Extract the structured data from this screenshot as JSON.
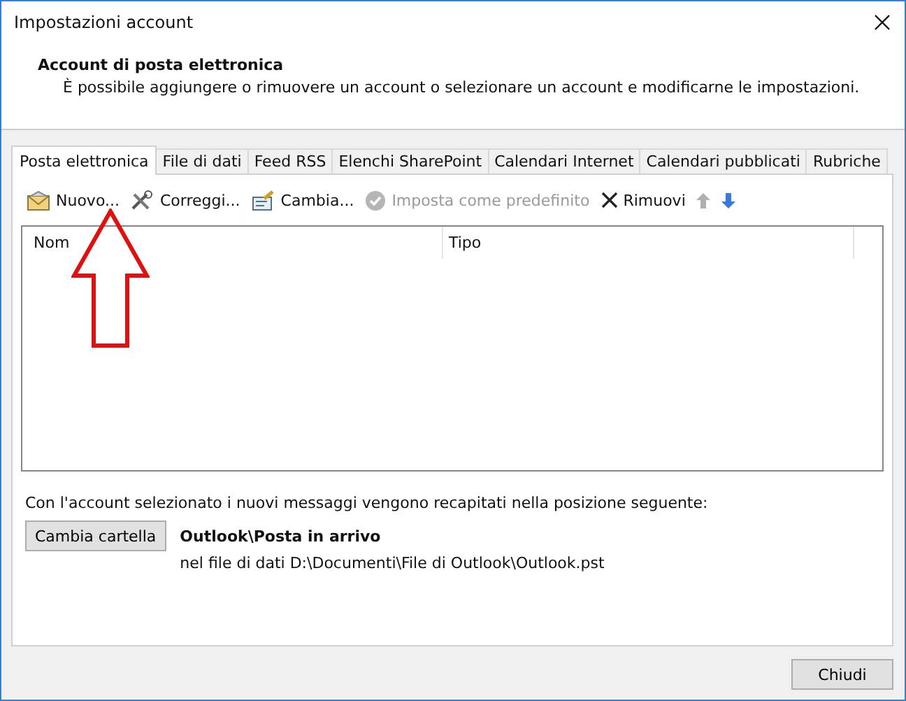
{
  "window": {
    "title": "Impostazioni account"
  },
  "header": {
    "title": "Account di posta elettronica",
    "description": "È possibile aggiungere o rimuovere un account o selezionare un account e modificarne le impostazioni."
  },
  "tabs": [
    {
      "label": "Posta elettronica",
      "selected": true
    },
    {
      "label": "File di dati",
      "selected": false
    },
    {
      "label": "Feed RSS",
      "selected": false
    },
    {
      "label": "Elenchi SharePoint",
      "selected": false
    },
    {
      "label": "Calendari Internet",
      "selected": false
    },
    {
      "label": "Calendari pubblicati",
      "selected": false
    },
    {
      "label": "Rubriche",
      "selected": false
    }
  ],
  "toolbar": [
    {
      "kind": "new",
      "label": "Nuovo...",
      "disabled": false
    },
    {
      "kind": "repair",
      "label": "Correggi...",
      "disabled": false
    },
    {
      "kind": "change",
      "label": "Cambia...",
      "disabled": false
    },
    {
      "kind": "default",
      "label": "Imposta come predefinito",
      "disabled": true
    },
    {
      "kind": "remove",
      "label": "Rimuovi",
      "disabled": false
    },
    {
      "kind": "up",
      "disabled": true
    },
    {
      "kind": "down",
      "disabled": false
    }
  ],
  "table": {
    "columns": [
      "Nom",
      "Tipo"
    ]
  },
  "delivery": {
    "text": "Con l'account selezionato i nuovi messaggi vengono recapitati nella posizione seguente:",
    "button": "Cambia cartella",
    "folder": "Outlook\\Posta in arrivo",
    "file": "nel file di dati D:\\Documenti\\File di Outlook\\Outlook.pst"
  },
  "buttons": [
    "Chiudi"
  ]
}
